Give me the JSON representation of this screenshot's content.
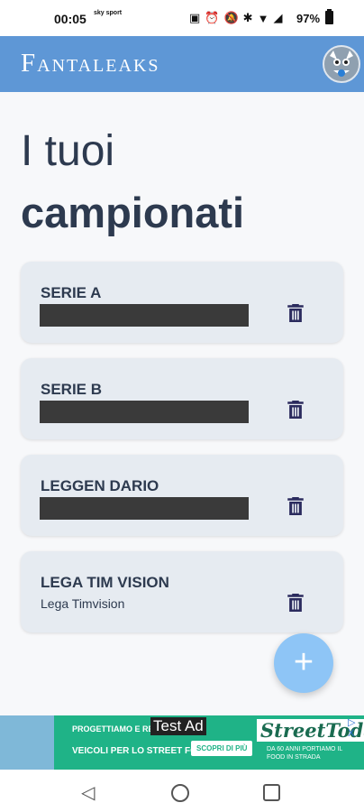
{
  "status_bar": {
    "time": "00:05",
    "sky_label": "sky sport",
    "battery": "97%"
  },
  "app_bar": {
    "title": "Fantaleaks"
  },
  "heading": {
    "line1": "I tuoi",
    "line2": "campionati"
  },
  "leagues": [
    {
      "name": "SERIE A",
      "subtitle": "",
      "redacted": true
    },
    {
      "name": "SERIE B",
      "subtitle": "",
      "redacted": true
    },
    {
      "name": "LEGGEN DARIO",
      "subtitle": "",
      "redacted": true
    },
    {
      "name": "LEGA TIM VISION",
      "subtitle": "Lega Timvision",
      "redacted": false
    }
  ],
  "fab": {
    "label": "+"
  },
  "ad": {
    "label": "Test Ad",
    "line1": "PROGETTIAMO E REA",
    "line2": "VEICOLI PER LO STREET FOOD",
    "cta": "SCOPRI DI PIÙ",
    "brand": "StreetToday",
    "brand_sub": "DA 60 ANNI PORTIAMO IL FOOD IN STRADA",
    "choices": "▷ X"
  },
  "colors": {
    "app_bar": "#5e97d6",
    "card_bg": "#e6ebf1",
    "text": "#2d3a4f",
    "fab": "#8ec5f6",
    "ad_bg": "#1fb387"
  }
}
